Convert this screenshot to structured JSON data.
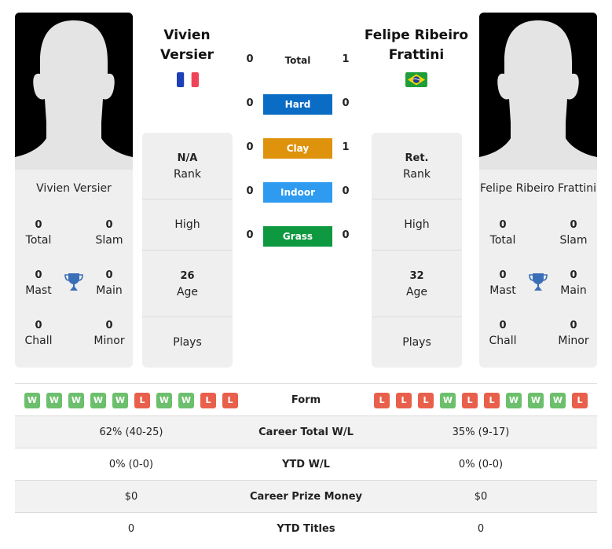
{
  "colors": {
    "hard": "#0a6cc4",
    "clay": "#df920c",
    "indoor": "#2e9bf0",
    "grass": "#0e9940",
    "win": "#6cbf6c",
    "loss": "#e8604c",
    "trophy": "#3a6fb8"
  },
  "player1": {
    "name_line1": "Vivien",
    "name_line2": "Versier",
    "card_name": "Vivien Versier",
    "flag": "france-flag",
    "stats": {
      "total": {
        "value": "0",
        "label": "Total"
      },
      "slam": {
        "value": "0",
        "label": "Slam"
      },
      "mast": {
        "value": "0",
        "label": "Mast"
      },
      "main": {
        "value": "0",
        "label": "Main"
      },
      "chall": {
        "value": "0",
        "label": "Chall"
      },
      "minor": {
        "value": "0",
        "label": "Minor"
      }
    },
    "info": {
      "rank_value": "N/A",
      "rank_label": "Rank",
      "high_label": "High",
      "age_value": "26",
      "age_label": "Age",
      "plays_label": "Plays"
    },
    "form": [
      "W",
      "W",
      "W",
      "W",
      "W",
      "L",
      "W",
      "W",
      "L",
      "L"
    ],
    "career_wl": "62% (40-25)",
    "ytd_wl": "0% (0-0)",
    "prize": "$0",
    "ytd_titles": "0"
  },
  "player2": {
    "name_line1": "Felipe Ribeiro",
    "name_line2": "Frattini",
    "card_name": "Felipe Ribeiro Frattini",
    "flag": "brazil-flag",
    "stats": {
      "total": {
        "value": "0",
        "label": "Total"
      },
      "slam": {
        "value": "0",
        "label": "Slam"
      },
      "mast": {
        "value": "0",
        "label": "Mast"
      },
      "main": {
        "value": "0",
        "label": "Main"
      },
      "chall": {
        "value": "0",
        "label": "Chall"
      },
      "minor": {
        "value": "0",
        "label": "Minor"
      }
    },
    "info": {
      "rank_value": "Ret.",
      "rank_label": "Rank",
      "high_label": "High",
      "age_value": "32",
      "age_label": "Age",
      "plays_label": "Plays"
    },
    "form": [
      "L",
      "L",
      "L",
      "W",
      "L",
      "L",
      "W",
      "W",
      "W",
      "L"
    ],
    "career_wl": "35% (9-17)",
    "ytd_wl": "0% (0-0)",
    "prize": "$0",
    "ytd_titles": "0"
  },
  "h2h": [
    {
      "label": "Total",
      "left": "0",
      "right": "1",
      "surface": "total"
    },
    {
      "label": "Hard",
      "left": "0",
      "right": "0",
      "surface": "hard"
    },
    {
      "label": "Clay",
      "left": "0",
      "right": "1",
      "surface": "clay"
    },
    {
      "label": "Indoor",
      "left": "0",
      "right": "0",
      "surface": "indoor"
    },
    {
      "label": "Grass",
      "left": "0",
      "right": "0",
      "surface": "grass"
    }
  ],
  "comparison_labels": {
    "form": "Form",
    "career_wl": "Career Total W/L",
    "ytd_wl": "YTD W/L",
    "prize": "Career Prize Money",
    "ytd_titles": "YTD Titles"
  }
}
